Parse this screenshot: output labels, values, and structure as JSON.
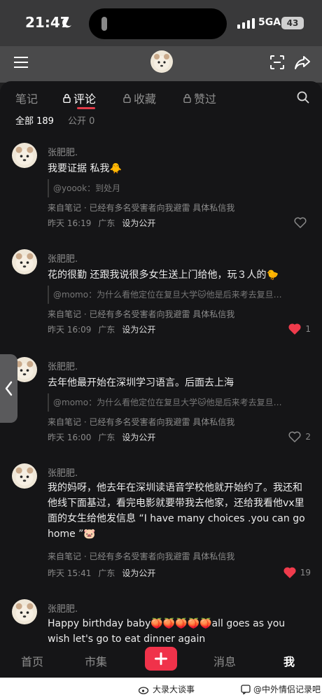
{
  "status": {
    "time": "21:47",
    "network": "5GA",
    "battery": "43"
  },
  "tabs": [
    {
      "label": "笔记",
      "locked": false,
      "active": false
    },
    {
      "label": "评论",
      "locked": true,
      "active": true
    },
    {
      "label": "收藏",
      "locked": true,
      "active": false
    },
    {
      "label": "赞过",
      "locked": true,
      "active": false
    }
  ],
  "subtabs": {
    "all": "全部 189",
    "public": "公开 0"
  },
  "comments": [
    {
      "name": "张肥肥.",
      "text": "我要证据 私我🐥",
      "quote": "@yoook：到处月",
      "source": "来自笔记 · 已经有多名受害者向我避雷 具体私信我",
      "time": "昨天 16:19",
      "region": "广东",
      "public_label": "设为公开",
      "likes": "",
      "liked": false
    },
    {
      "name": "张肥肥.",
      "text": "花的很勤 还跟我说很多女生送上门给他，玩３人的🐤",
      "quote": "@momo：为什么看他定位在复旦大学🐱他是后来考去复旦…",
      "source": "来自笔记 · 已经有多名受害者向我避雷 具体私信我",
      "time": "昨天 16:09",
      "region": "广东",
      "public_label": "设为公开",
      "likes": "1",
      "liked": true
    },
    {
      "name": "张肥肥.",
      "text": "去年他最开始在深圳学习语言。后面去上海",
      "quote": "@momo：为什么看他定位在复旦大学🐱他是后来考去复旦…",
      "source": "来自笔记 · 已经有多名受害者向我避雷 具体私信我",
      "time": "昨天 16:00",
      "region": "广东",
      "public_label": "设为公开",
      "likes": "2",
      "liked": false
    },
    {
      "name": "张肥肥.",
      "text": "我的妈呀，他去年在深圳读语音学校他就开始约了。我还和他线下面基过，看完电影就要带我去他家，还给我看他vx里面的女生给他发信息 “I have many choices .you can go home ”🐷",
      "quote": "",
      "source": "来自笔记 · 已经有多名受害者向我避雷 具体私信我",
      "time": "昨天 15:41",
      "region": "广东",
      "public_label": "设为公开",
      "likes": "19",
      "liked": true
    },
    {
      "name": "张肥肥.",
      "text": "Happy birthday baby🍑🍑🍑🍑🍑all goes as you wish let's go to eat dinner again",
      "quote": "",
      "source": "",
      "time": "",
      "region": "",
      "public_label": "",
      "likes": "",
      "liked": false
    }
  ],
  "bottom_nav": {
    "home": "首页",
    "market": "市集",
    "messages": "消息",
    "me": "我"
  },
  "watermarks": {
    "left": "大录大谈事",
    "right": "@中外情侣记录吧"
  },
  "colors": {
    "accent": "#f0324a",
    "like_red": "#ef3b4c",
    "panel_bg": "#151517"
  },
  "icons": [
    "menu-icon",
    "avatar",
    "scan-icon",
    "share-icon",
    "lock-icon",
    "search-icon",
    "heart-icon",
    "plus-icon",
    "chevron-left-icon",
    "weibo-icon"
  ]
}
